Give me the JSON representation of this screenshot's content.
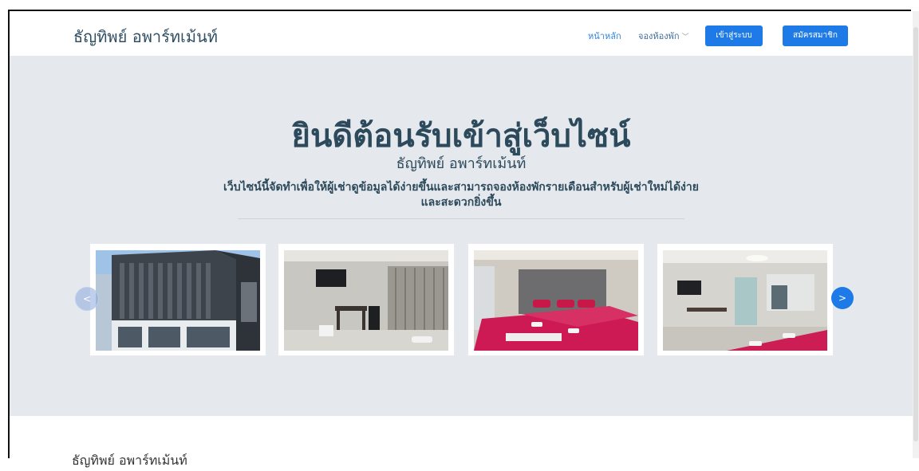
{
  "brand": "ธัญทิพย์ อพาร์ทเม้นท์",
  "nav": {
    "home": "หน้าหลัก",
    "booking": "จองห้องพัก",
    "login": "เข้าสู่ระบบ",
    "register": "สมัครสมาชิก"
  },
  "hero": {
    "title": "ยินดีต้อนรับเข้าสู่เว็บไซน์",
    "subtitle": "ธัญทิพย์ อพาร์ทเม้นท์",
    "description": "เว็บไซน์นี้จัดทำเพื่อให้ผู้เช่าดูข้อมูลได้ง่ายขึ้นและสามารถจองห้องพักรายเดือนสำหรับผู้เช่าใหม่ได้ง่ายและสะดวกยิ่งขึ้น"
  },
  "carousel": {
    "prev": "<",
    "next": ">"
  },
  "section": {
    "heading": "ธัญทิพย์ อพาร์ทเม้นท์"
  },
  "colors": {
    "accent": "#1e7ae6",
    "heading": "#2c4a5c",
    "hero_bg": "#e5e8ec"
  }
}
